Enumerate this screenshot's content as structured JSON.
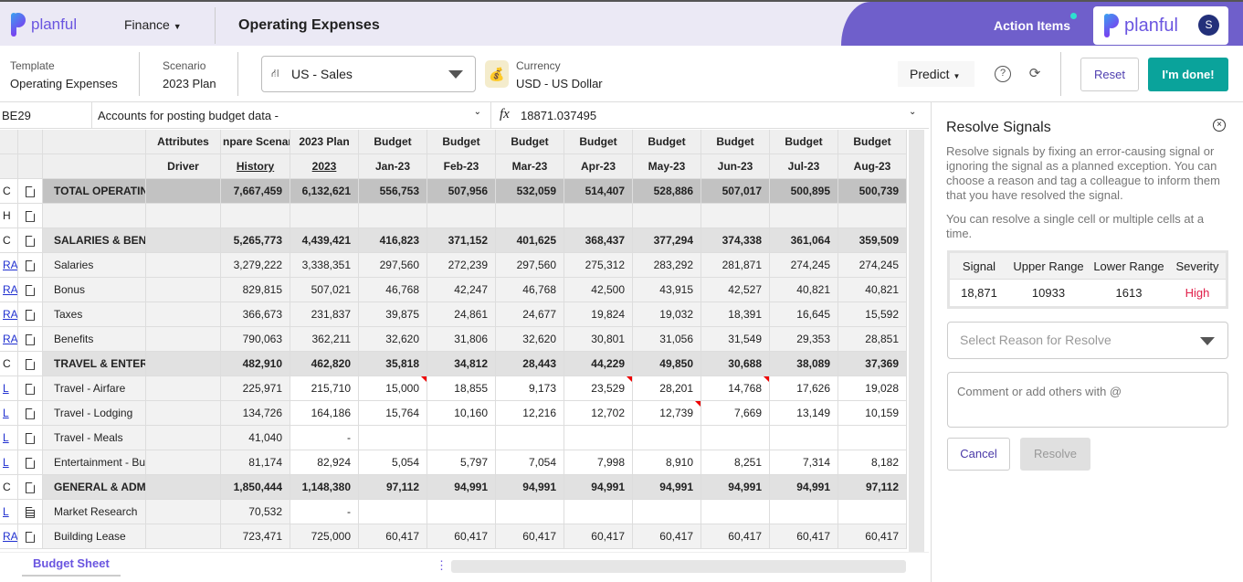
{
  "header": {
    "brand": "planful",
    "menu": "Finance",
    "title": "Operating Expenses",
    "action_items": "Action Items",
    "avatar": "S",
    "purple": "#6f5fcb",
    "accent": "#0aa39b"
  },
  "toolbar": {
    "template_label": "Template",
    "template_value": "Operating Expenses",
    "scenario_label": "Scenario",
    "scenario_value": "2023 Plan",
    "entity": "US - Sales",
    "currency_label": "Currency",
    "currency_value": "USD - US Dollar",
    "predict": "Predict",
    "reset": "Reset",
    "done": "I'm done!"
  },
  "formula": {
    "cell": "BE29",
    "account": "Accounts for posting budget data -",
    "fx": "fx",
    "value": "18871.037495"
  },
  "grid": {
    "header1": [
      "Attributes",
      "npare Scenar",
      "2023 Plan",
      "Budget",
      "Budget",
      "Budget",
      "Budget",
      "Budget",
      "Budget",
      "Budget",
      "Budget"
    ],
    "header2": [
      "Driver",
      "History",
      "2023",
      "Jan-23",
      "Feb-23",
      "Mar-23",
      "Apr-23",
      "May-23",
      "Jun-23",
      "Jul-23",
      "Aug-23"
    ],
    "rows": [
      {
        "type": "C",
        "style": "total",
        "name": "TOTAL OPERATING",
        "history": "7,667,459",
        "plan": "6,132,621",
        "months": [
          "556,753",
          "507,956",
          "532,059",
          "514,407",
          "528,886",
          "507,017",
          "500,895",
          "500,739"
        ]
      },
      {
        "type": "H",
        "style": "ro",
        "name": "",
        "history": "",
        "plan": "",
        "months": [
          "",
          "",
          "",
          "",
          "",
          "",
          "",
          ""
        ]
      },
      {
        "type": "C",
        "style": "sub",
        "name": "SALARIES & BENEFITS",
        "history": "5,265,773",
        "plan": "4,439,421",
        "months": [
          "416,823",
          "371,152",
          "401,625",
          "368,437",
          "377,294",
          "374,338",
          "361,064",
          "359,509"
        ]
      },
      {
        "type": "RA",
        "style": "ro",
        "name": "Salaries",
        "history": "3,279,222",
        "plan": "3,338,351",
        "months": [
          "297,560",
          "272,239",
          "297,560",
          "275,312",
          "283,292",
          "281,871",
          "274,245",
          "274,245"
        ]
      },
      {
        "type": "RA",
        "style": "ro",
        "name": "Bonus",
        "history": "829,815",
        "plan": "507,021",
        "months": [
          "46,768",
          "42,247",
          "46,768",
          "42,500",
          "43,915",
          "42,527",
          "40,821",
          "40,821"
        ]
      },
      {
        "type": "RA",
        "style": "ro",
        "name": "Taxes",
        "history": "366,673",
        "plan": "231,837",
        "months": [
          "39,875",
          "24,861",
          "24,677",
          "19,824",
          "19,032",
          "18,391",
          "16,645",
          "15,592"
        ]
      },
      {
        "type": "RA",
        "style": "ro",
        "name": "Benefits",
        "history": "790,063",
        "plan": "362,211",
        "months": [
          "32,620",
          "31,806",
          "32,620",
          "30,801",
          "31,056",
          "31,549",
          "29,353",
          "28,851"
        ]
      },
      {
        "type": "C",
        "style": "sub",
        "name": "TRAVEL & ENTERTAINMENT",
        "history": "482,910",
        "plan": "462,820",
        "months": [
          "35,818",
          "34,812",
          "28,443",
          "44,229",
          "49,850",
          "30,688",
          "38,089",
          "37,369"
        ]
      },
      {
        "type": "L",
        "style": "in",
        "name": "Travel - Airfare",
        "history": "225,971",
        "plan": "215,710",
        "months": [
          "15,000",
          "18,855",
          "9,173",
          "23,529",
          "28,201",
          "14,768",
          "17,626",
          "19,028"
        ],
        "flags": [
          0,
          3,
          5
        ]
      },
      {
        "type": "L",
        "style": "in",
        "name": "Travel - Lodging",
        "history": "134,726",
        "plan": "164,186",
        "months": [
          "15,764",
          "10,160",
          "12,216",
          "12,702",
          "12,739",
          "7,669",
          "13,149",
          "10,159"
        ],
        "flags": [
          4
        ]
      },
      {
        "type": "L",
        "style": "in",
        "name": "Travel - Meals",
        "history": "41,040",
        "plan": "-",
        "months": [
          "",
          "",
          "",
          "",
          "",
          "",
          "",
          ""
        ]
      },
      {
        "type": "L",
        "style": "in",
        "name": "Entertainment - Business",
        "history": "81,174",
        "plan": "82,924",
        "months": [
          "5,054",
          "5,797",
          "7,054",
          "7,998",
          "8,910",
          "8,251",
          "7,314",
          "8,182"
        ]
      },
      {
        "type": "C",
        "style": "sub",
        "name": "GENERAL & ADMINISTRATIVE",
        "history": "1,850,444",
        "plan": "1,148,380",
        "months": [
          "97,112",
          "94,991",
          "94,991",
          "94,991",
          "94,991",
          "94,991",
          "94,991",
          "97,112"
        ]
      },
      {
        "type": "L",
        "style": "in",
        "name": "Market Research",
        "history": "70,532",
        "plan": "-",
        "months": [
          "",
          "",
          "",
          "",
          "",
          "",
          "",
          ""
        ],
        "note": true
      },
      {
        "type": "RA",
        "style": "ro",
        "name": "Building Lease",
        "history": "723,471",
        "plan": "725,000",
        "months": [
          "60,417",
          "60,417",
          "60,417",
          "60,417",
          "60,417",
          "60,417",
          "60,417",
          "60,417"
        ]
      }
    ]
  },
  "sheet_tab": "Budget Sheet",
  "panel": {
    "title": "Resolve Signals",
    "desc1": "Resolve signals by fixing an error-causing signal or ignoring the signal as a planned exception. You can choose a reason and tag a colleague to inform them that you have resolved the signal.",
    "desc2": "You can resolve a single cell or multiple cells at a time.",
    "cols": [
      "Signal",
      "Upper Range",
      "Lower Range",
      "Severity"
    ],
    "row": [
      "18,871",
      "10933",
      "1613",
      "High"
    ],
    "severity_color": "#e0204a",
    "reason_placeholder": "Select Reason for Resolve",
    "comment_placeholder": "Comment or add others with @",
    "cancel": "Cancel",
    "resolve": "Resolve"
  }
}
